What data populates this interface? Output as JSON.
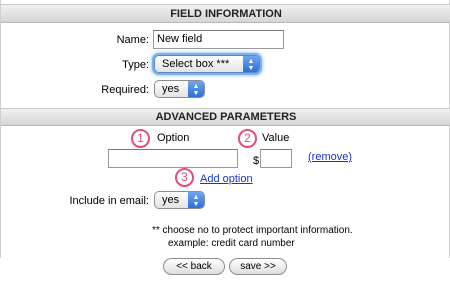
{
  "sections": {
    "field_info_title": "FIELD INFORMATION",
    "advanced_title": "ADVANCED PARAMETERS"
  },
  "field": {
    "name_label": "Name:",
    "name_value": "New field",
    "type_label": "Type:",
    "type_value": "Select box ***",
    "required_label": "Required:",
    "required_value": "yes"
  },
  "advanced": {
    "option_header": "Option",
    "value_header": "Value",
    "option_value": "",
    "currency_symbol": "$",
    "value_value": "",
    "remove_link": "(remove)",
    "add_option_link": "Add option",
    "include_label": "Include in email:",
    "include_value": "yes",
    "note_line1": "** choose no to protect important information.",
    "note_line2": "example: credit card number",
    "callouts": [
      "1",
      "2",
      "3"
    ]
  },
  "nav": {
    "back_label": "<< back",
    "save_label": "save >>"
  },
  "colors": {
    "callout": "#e44b84",
    "link": "#1a35c8",
    "select_arrow": "#2e6fd8"
  }
}
